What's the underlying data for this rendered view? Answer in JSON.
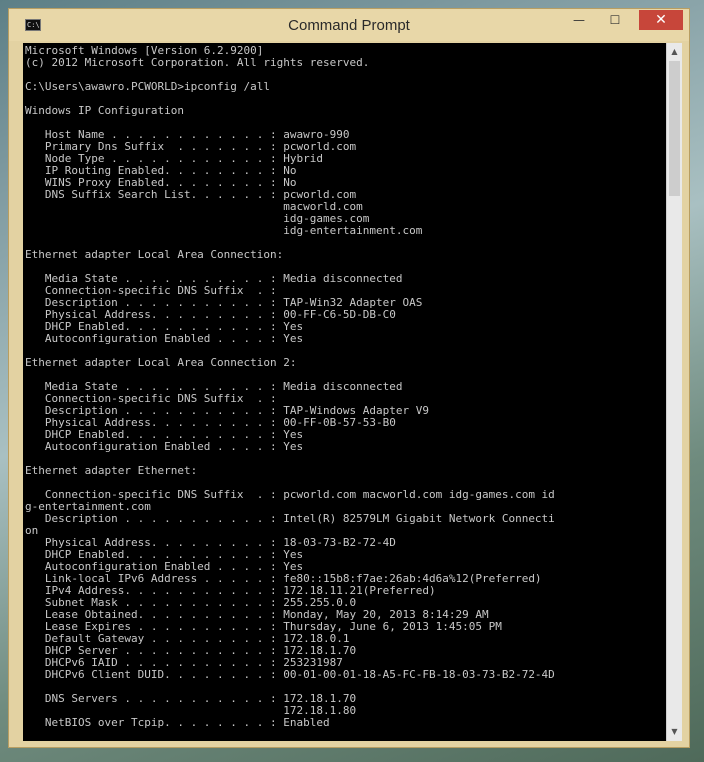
{
  "window": {
    "title": "Command Prompt",
    "icon_label": "C:\\",
    "controls": {
      "minimize": "—",
      "maximize": "☐",
      "close": "✕"
    }
  },
  "console": {
    "lines": [
      "Microsoft Windows [Version 6.2.9200]",
      "(c) 2012 Microsoft Corporation. All rights reserved.",
      "",
      "C:\\Users\\awawro.PCWORLD>ipconfig /all",
      "",
      "Windows IP Configuration",
      "",
      "   Host Name . . . . . . . . . . . . : awawro-990",
      "   Primary Dns Suffix  . . . . . . . : pcworld.com",
      "   Node Type . . . . . . . . . . . . : Hybrid",
      "   IP Routing Enabled. . . . . . . . : No",
      "   WINS Proxy Enabled. . . . . . . . : No",
      "   DNS Suffix Search List. . . . . . : pcworld.com",
      "                                       macworld.com",
      "                                       idg-games.com",
      "                                       idg-entertainment.com",
      "",
      "Ethernet adapter Local Area Connection:",
      "",
      "   Media State . . . . . . . . . . . : Media disconnected",
      "   Connection-specific DNS Suffix  . :",
      "   Description . . . . . . . . . . . : TAP-Win32 Adapter OAS",
      "   Physical Address. . . . . . . . . : 00-FF-C6-5D-DB-C0",
      "   DHCP Enabled. . . . . . . . . . . : Yes",
      "   Autoconfiguration Enabled . . . . : Yes",
      "",
      "Ethernet adapter Local Area Connection 2:",
      "",
      "   Media State . . . . . . . . . . . : Media disconnected",
      "   Connection-specific DNS Suffix  . :",
      "   Description . . . . . . . . . . . : TAP-Windows Adapter V9",
      "   Physical Address. . . . . . . . . : 00-FF-0B-57-53-B0",
      "   DHCP Enabled. . . . . . . . . . . : Yes",
      "   Autoconfiguration Enabled . . . . : Yes",
      "",
      "Ethernet adapter Ethernet:",
      "",
      "   Connection-specific DNS Suffix  . : pcworld.com macworld.com idg-games.com id",
      "g-entertainment.com",
      "   Description . . . . . . . . . . . : Intel(R) 82579LM Gigabit Network Connecti",
      "on",
      "   Physical Address. . . . . . . . . : 18-03-73-B2-72-4D",
      "   DHCP Enabled. . . . . . . . . . . : Yes",
      "   Autoconfiguration Enabled . . . . : Yes",
      "   Link-local IPv6 Address . . . . . : fe80::15b8:f7ae:26ab:4d6a%12(Preferred)",
      "   IPv4 Address. . . . . . . . . . . : 172.18.11.21(Preferred)",
      "   Subnet Mask . . . . . . . . . . . : 255.255.0.0",
      "   Lease Obtained. . . . . . . . . . : Monday, May 20, 2013 8:14:29 AM",
      "   Lease Expires . . . . . . . . . . : Thursday, June 6, 2013 1:45:05 PM",
      "   Default Gateway . . . . . . . . . : 172.18.0.1",
      "   DHCP Server . . . . . . . . . . . : 172.18.1.70",
      "   DHCPv6 IAID . . . . . . . . . . . : 253231987",
      "   DHCPv6 Client DUID. . . . . . . . : 00-01-00-01-18-A5-FC-FB-18-03-73-B2-72-4D",
      "",
      "   DNS Servers . . . . . . . . . . . : 172.18.1.70",
      "                                       172.18.1.80",
      "   NetBIOS over Tcpip. . . . . . . . : Enabled"
    ]
  },
  "scrollbar": {
    "up_arrow": "▲",
    "down_arrow": "▼"
  },
  "colors": {
    "console_background": "#000000",
    "console_text": "#c8c8c8",
    "title_bar": "#e8d7a8",
    "close_button": "#c7463a"
  }
}
